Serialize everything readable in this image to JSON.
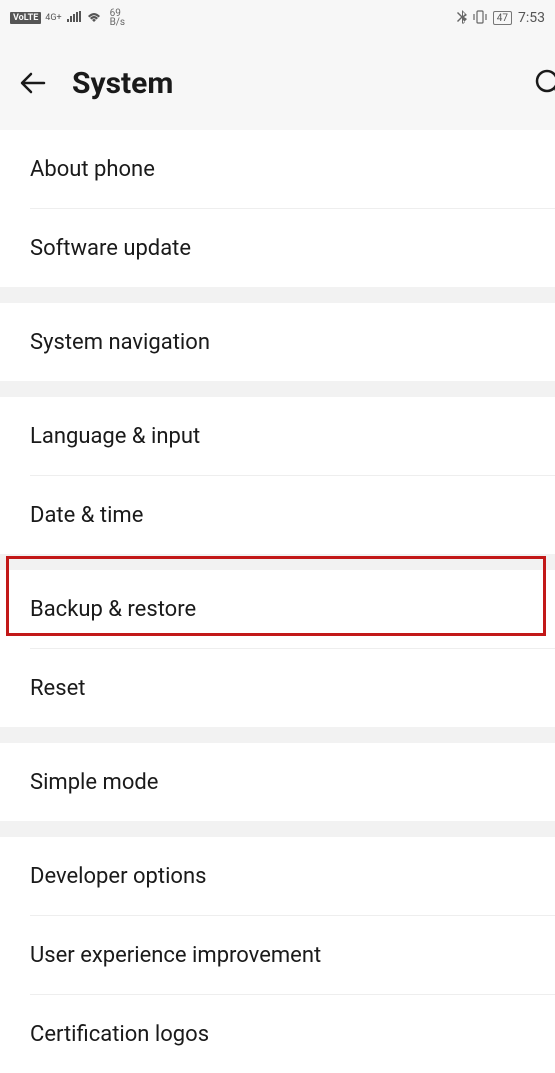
{
  "status": {
    "volte": "VoLTE",
    "net_label": "4G+",
    "speed_value": "69",
    "speed_unit": "B/s",
    "battery": "47",
    "time": "7:53"
  },
  "header": {
    "title": "System"
  },
  "groups": [
    {
      "items": [
        "About phone",
        "Software update"
      ]
    },
    {
      "items": [
        "System navigation"
      ]
    },
    {
      "items": [
        "Language & input",
        "Date & time"
      ]
    },
    {
      "items": [
        "Backup & restore",
        "Reset"
      ]
    },
    {
      "items": [
        "Simple mode"
      ]
    },
    {
      "items": [
        "Developer options",
        "User experience improvement",
        "Certification logos"
      ]
    }
  ]
}
